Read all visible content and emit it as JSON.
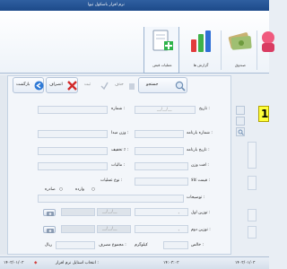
{
  "window": {
    "title": "نرم افزار باسکول تیوا"
  },
  "ribbon": {
    "items": [
      {
        "label": "",
        "icon": "customers-icon"
      },
      {
        "label": "صندوق",
        "icon": "money-icon"
      },
      {
        "label": "گزارش ها",
        "icon": "reports-chart-icon"
      },
      {
        "label": "عملیات قبض",
        "icon": "receipt-add-icon"
      }
    ]
  },
  "toolbar": {
    "search_label": "جستجو",
    "delete_label": "حذف",
    "confirm_label": "ثبت",
    "cancel_label": "انصراف",
    "back_label": "بازگشت"
  },
  "form": {
    "date_label": "تاریخ :",
    "date_value": "__/__/__",
    "number_label": "شماره :",
    "load_number_label": "شماره بارنامه :",
    "origin_weight_label": "وزن مبدا :",
    "load_date_label": "تاریخ بارنامه :",
    "discount_label": "تخفیف ٪ :",
    "loss_weight_label": "افت وزن :",
    "tax_label": "مالیات :",
    "unit_price_label": "قیمت کالا :",
    "operation_type_label": "نوع عملیات :",
    "in_label": "وارده",
    "out_label": "صادره",
    "description_label": "توضیحات :",
    "first_weigh_label": "توزین اول :",
    "second_weigh_label": "توزین دوم :",
    "first_weigh_date": "__/__/__",
    "second_weigh_date": "__/__/__",
    "net_label": "خالص :",
    "unit_label": "کیلوگرم",
    "consumption_total_label": "مجموع مصرف :",
    "currency_label": "ریال",
    "tiny_digit": "۰"
  },
  "side": {
    "badge": "1"
  },
  "status": {
    "date": "۱۴۰۳/۰۱/۰۳",
    "time": "۱۴:۰۳:۰۳",
    "hint": "انتخاب استایل نرم افزار :",
    "app_date": "۱۴۰۳/۰۱/۰۳"
  },
  "colors": {
    "title_bar": "#1d4a8a",
    "accent_yellow": "#ffff3a",
    "panel_bg": "#f3f6fa"
  }
}
